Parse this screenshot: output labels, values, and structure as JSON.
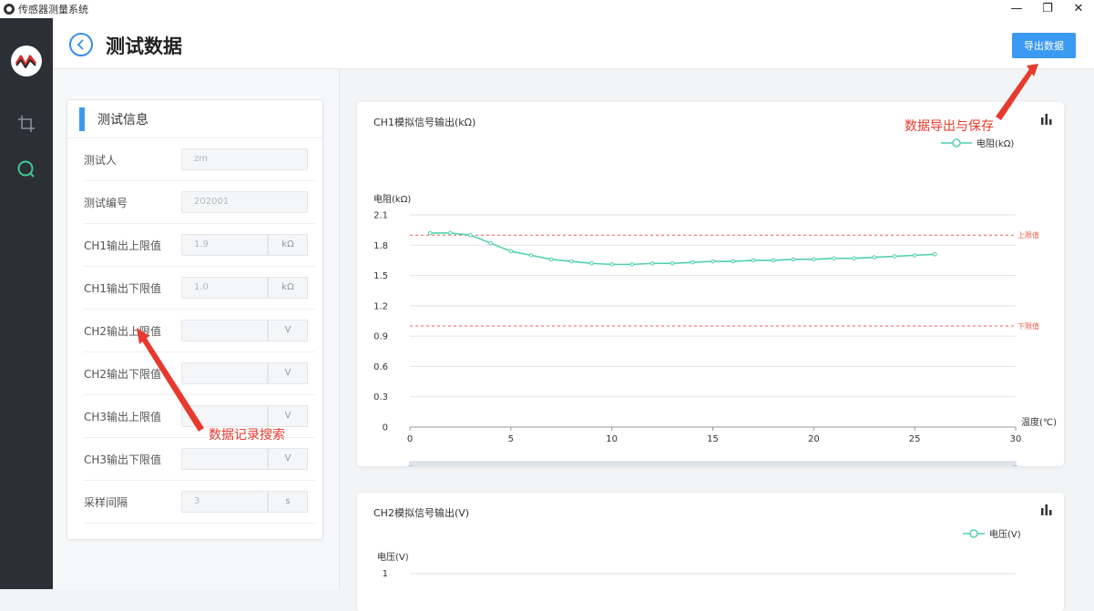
{
  "window": {
    "title": "传感器测量系统",
    "min": "—",
    "max": "❐",
    "close": "✕"
  },
  "header": {
    "title": "测试数据",
    "export_label": "导出数据"
  },
  "info": {
    "title": "测试信息",
    "rows": [
      {
        "label": "测试人",
        "value": "zm",
        "unit": null
      },
      {
        "label": "测试编号",
        "value": "202001",
        "unit": null
      },
      {
        "label": "CH1输出上限值",
        "value": "1.9",
        "unit": "kΩ"
      },
      {
        "label": "CH1输出下限值",
        "value": "1.0",
        "unit": "kΩ"
      },
      {
        "label": "CH2输出上限值",
        "value": "",
        "unit": "V"
      },
      {
        "label": "CH2输出下限值",
        "value": "",
        "unit": "V"
      },
      {
        "label": "CH3输出上限值",
        "value": "",
        "unit": "V"
      },
      {
        "label": "CH3输出下限值",
        "value": "",
        "unit": "V"
      },
      {
        "label": "采样间隔",
        "value": "3",
        "unit": "s"
      }
    ]
  },
  "annotations": {
    "export_note": "数据导出与保存",
    "search_note": "数据记录搜索"
  },
  "colors": {
    "accent": "#3a99f0",
    "series": "#4fd1b0",
    "limit": "#ef5b4c",
    "annotation": "#e63a2e"
  },
  "chart_data": [
    {
      "type": "line",
      "title": "CH1模拟信号输出(kΩ)",
      "ylabel": "电阻(kΩ)",
      "xlabel": "温度(℃)",
      "xlim": [
        0,
        30
      ],
      "ylim": [
        0,
        2.1
      ],
      "xticks": [
        "0",
        "5",
        "10",
        "15",
        "20",
        "25",
        "30"
      ],
      "yticks": [
        "0",
        "0.3",
        "0.6",
        "0.9",
        "1.2",
        "1.5",
        "1.8",
        "2.1"
      ],
      "legend": "top-right",
      "series": [
        {
          "name": "电阻(kΩ)",
          "x": [
            1,
            2,
            3,
            4,
            5,
            6,
            7,
            8,
            9,
            10,
            11,
            12,
            13,
            14,
            15,
            16,
            17,
            18,
            19,
            20,
            21,
            22,
            23,
            24,
            25,
            26
          ],
          "values": [
            1.92,
            1.92,
            1.9,
            1.82,
            1.74,
            1.7,
            1.66,
            1.64,
            1.62,
            1.61,
            1.61,
            1.62,
            1.62,
            1.63,
            1.64,
            1.64,
            1.65,
            1.65,
            1.66,
            1.66,
            1.67,
            1.67,
            1.68,
            1.69,
            1.7,
            1.71
          ]
        }
      ],
      "limits": [
        {
          "label": "上限值",
          "value": 1.9
        },
        {
          "label": "下限值",
          "value": 1.0
        }
      ]
    },
    {
      "type": "line",
      "title": "CH2模拟信号输出(V)",
      "ylabel": "电压(V)",
      "yticks": [
        "1"
      ],
      "legend": "top-right",
      "series": [
        {
          "name": "电压(V)",
          "values": []
        }
      ]
    }
  ]
}
